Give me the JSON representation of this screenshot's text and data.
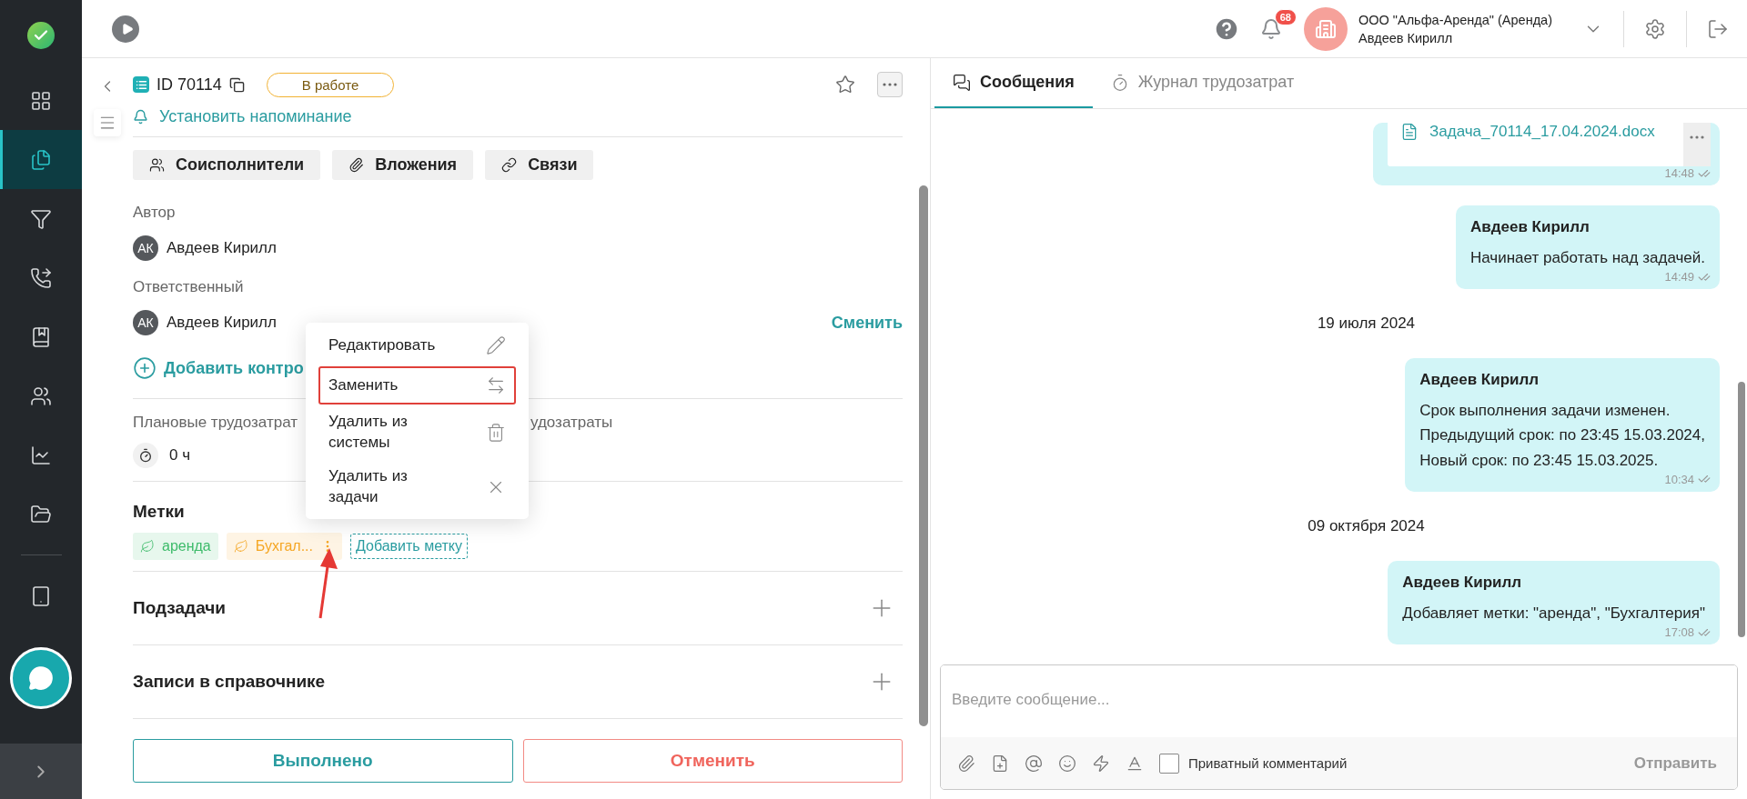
{
  "topbar": {
    "notifications": "68",
    "org": "ООО \"Альфа-Аренда\" (Аренда)",
    "user": "Авдеев Кирилл"
  },
  "sidebar": {
    "items": [
      {
        "selected": false
      },
      {
        "selected": true
      },
      {
        "selected": false
      },
      {
        "selected": false
      },
      {
        "selected": false
      },
      {
        "selected": false
      },
      {
        "selected": false
      },
      {
        "selected": false
      },
      {
        "selected": false
      }
    ]
  },
  "task": {
    "id": "ID 70114",
    "status": "В работе",
    "reminder": "Установить напоминание",
    "actions": [
      "Соисполнители",
      "Вложения",
      "Связи"
    ],
    "author_label": "Автор",
    "author": {
      "initials": "АК",
      "name": "Авдеев Кирилл"
    },
    "responsible_label": "Ответственный",
    "responsible": {
      "initials": "АК",
      "name": "Авдеев Кирилл"
    },
    "change": "Сменить",
    "add_controller": "Добавить контро",
    "effort_labels": [
      "Плановые трудозатрат",
      "удозатраты"
    ],
    "planned_effort": "0 ч",
    "tags_title": "Метки",
    "tags": [
      {
        "label": "аренда",
        "color": "#3dbb6a",
        "menu_open": false
      },
      {
        "label": "Бухгал...",
        "color": "#f5a623",
        "menu_open": true
      }
    ],
    "add_tag": "Добавить метку",
    "sections": [
      "Подзадачи",
      "Записи в справочнике"
    ],
    "done": "Выполнено",
    "cancel": "Отменить"
  },
  "context_menu": {
    "items": [
      {
        "label": "Редактировать",
        "selected": false
      },
      {
        "label": "Заменить",
        "selected": true
      },
      {
        "label": "Удалить из системы",
        "selected": false
      },
      {
        "label": "Удалить из задачи",
        "selected": false
      }
    ]
  },
  "tabs": [
    {
      "label": "Сообщения",
      "selected": true
    },
    {
      "label": "Журнал трудозатрат",
      "selected": false
    }
  ],
  "messages": [
    {
      "kind": "file",
      "file": "Задача_70114_17.04.2024.docx",
      "time": "14:48"
    },
    {
      "kind": "message",
      "author": "Авдеев Кирилл",
      "text": "Начинает работать над задачей.",
      "time": "14:49"
    },
    {
      "kind": "date",
      "text": "19 июля 2024"
    },
    {
      "kind": "message",
      "author": "Авдеев Кирилл",
      "text": "Срок выполнения задачи изменен.\nПредыдущий срок: по 23:45 15.03.2024,\nНовый срок: по 23:45 15.03.2025.",
      "time": "10:34"
    },
    {
      "kind": "date",
      "text": "09 октября 2024"
    },
    {
      "kind": "message",
      "author": "Авдеев Кирилл",
      "text": "Добавляет метки: \"аренда\", \"Бухгалтерия\"",
      "time": "17:08"
    }
  ],
  "composer": {
    "placeholder": "Введите сообщение...",
    "private_label": "Приватный комментарий",
    "private_checked": false,
    "send": "Отправить",
    "send_disabled": true
  }
}
